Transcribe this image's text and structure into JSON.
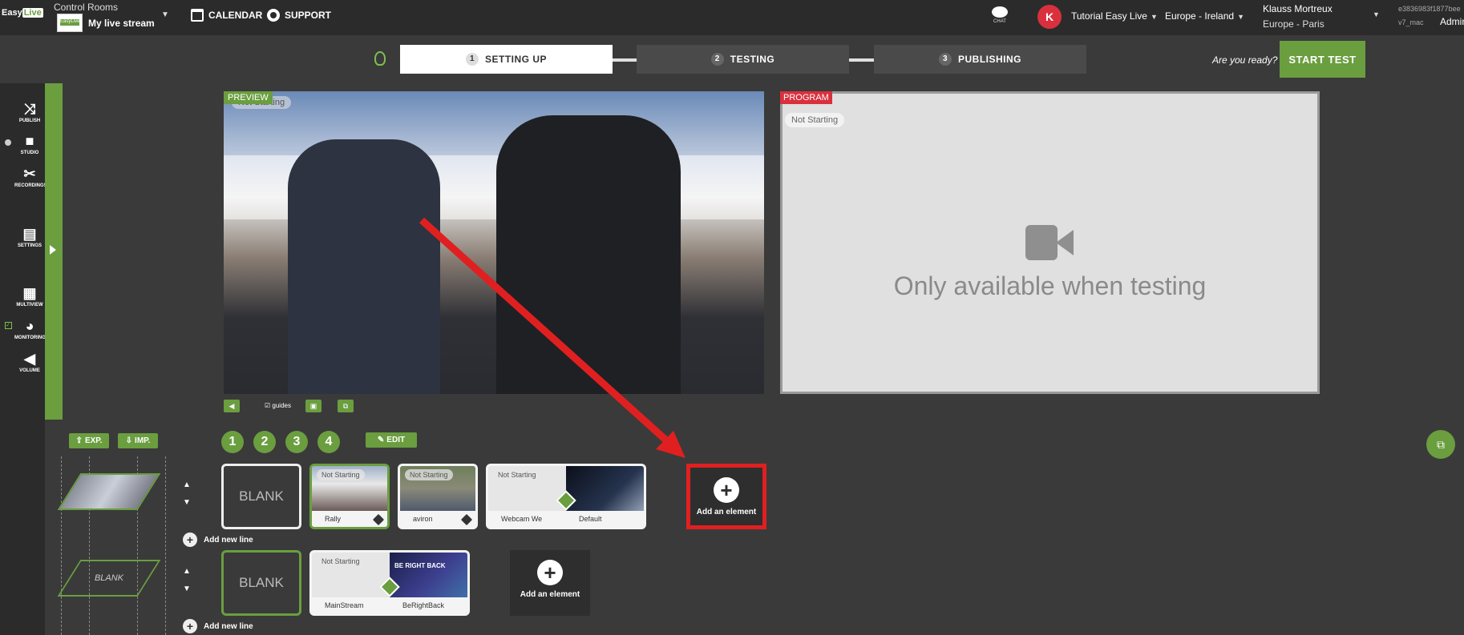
{
  "topbar": {
    "logo_easy": "Easy",
    "logo_live": "Live",
    "control_rooms": "Control Rooms",
    "stream_name": "My live stream",
    "stream_thumb_label": "EasyLive",
    "nav": {
      "calendar": "CALENDAR",
      "support": "SUPPORT"
    },
    "chat_label": "CHAT",
    "avatar_letter": "K",
    "account": "Tutorial Easy Live",
    "region": "Europe - Ireland",
    "user_name": "Klauss Mortreux",
    "user_tz": "Europe - Paris",
    "hash": "e3836983f1877bee",
    "version": "v7_mac",
    "role": "Admin"
  },
  "steps": [
    {
      "num": "1",
      "label": "SETTING UP",
      "active": true
    },
    {
      "num": "2",
      "label": "TESTING",
      "active": false
    },
    {
      "num": "3",
      "label": "PUBLISHING",
      "active": false
    }
  ],
  "ready_text": "Are you ready?",
  "start_test": "START TEST",
  "sidebar": {
    "publish": "PUBLISH",
    "studio": "STUDIO",
    "recordings": "RECORDINGS",
    "settings": "SETTINGS",
    "multiview": "MULTIVIEW",
    "monitoring": "MONITORING",
    "volume": "VOLUME"
  },
  "preview": {
    "tag": "PREVIEW",
    "status": "Not Starting"
  },
  "program": {
    "tag": "PROGRAM",
    "status": "Not Starting",
    "message": "Only available when testing"
  },
  "preview_controls": {
    "guides": "guides"
  },
  "bottom": {
    "exp": "EXP.",
    "imp": "IMP.",
    "layers": [
      "1",
      "2",
      "3",
      "4"
    ],
    "edit": "EDIT",
    "add_new_line": "Add new line",
    "add_element": "Add an element",
    "blank": "BLANK",
    "row1": [
      {
        "caption": "Rally",
        "status": "Not Starting"
      },
      {
        "caption": "aviron",
        "status": "Not Starting"
      },
      {
        "caption": "Webcam We",
        "status": "Not Starting"
      },
      {
        "caption": "Default",
        "status": ""
      }
    ],
    "row2": [
      {
        "caption": "MainStream",
        "status": "Not Starting"
      },
      {
        "caption": "BeRightBack",
        "status": ""
      }
    ],
    "brb_thumb_text": "BE RIGHT BACK"
  },
  "colors": {
    "accent": "#6a9e3f",
    "program": "#d9303e",
    "highlight": "#e02020"
  }
}
